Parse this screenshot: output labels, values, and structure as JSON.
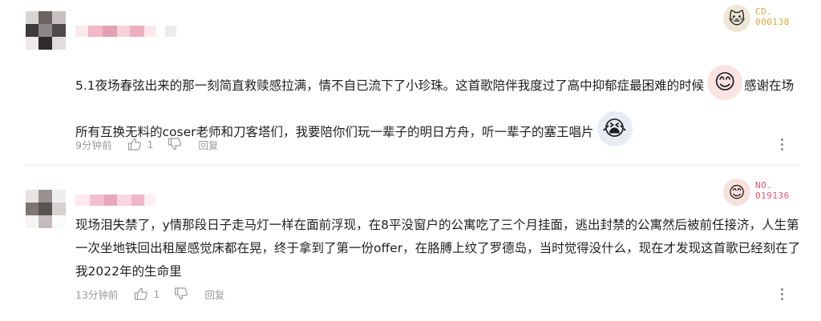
{
  "comments": [
    {
      "text_part1": "5.1夜场春弦出来的那一刻简直救赎感拉满，情不自已流下了小珍珠。这首歌陪伴我度过了高中抑郁症最困难的时候",
      "sticker1": "😊",
      "text_part2": "感谢在场所有互换无料的coser老师和刀客塔们，我要陪你们玩一辈子的明日方舟，听一辈子的塞王唱片",
      "sticker2": "😭",
      "time": "9分钟前",
      "likes": "1",
      "reply_label": "回复",
      "badge_label": "CD.",
      "badge_number": "000138",
      "badge_color": "#d4a93a",
      "badge_icon": "🐱"
    },
    {
      "text": "现场泪失禁了，y情那段日子走马灯一样在面前浮现，在8平没窗户的公寓吃了三个月挂面，逃出封禁的公寓然后被前任接济，人生第一次坐地铁回出租屋感觉床都在晃，终于拿到了第一份offer，在胳膊上纹了罗德岛，当时觉得没什么，现在才发现这首歌已经刻在了我2022年的生命里",
      "time": "13分钟前",
      "likes": "1",
      "reply_label": "回复",
      "badge_label": "NO.",
      "badge_number": "019136",
      "badge_color": "#e0556b",
      "badge_icon": "😊"
    }
  ],
  "icons": {
    "like": "thumbs-up-icon",
    "dislike": "thumbs-down-icon",
    "more": "more-vertical-icon"
  }
}
